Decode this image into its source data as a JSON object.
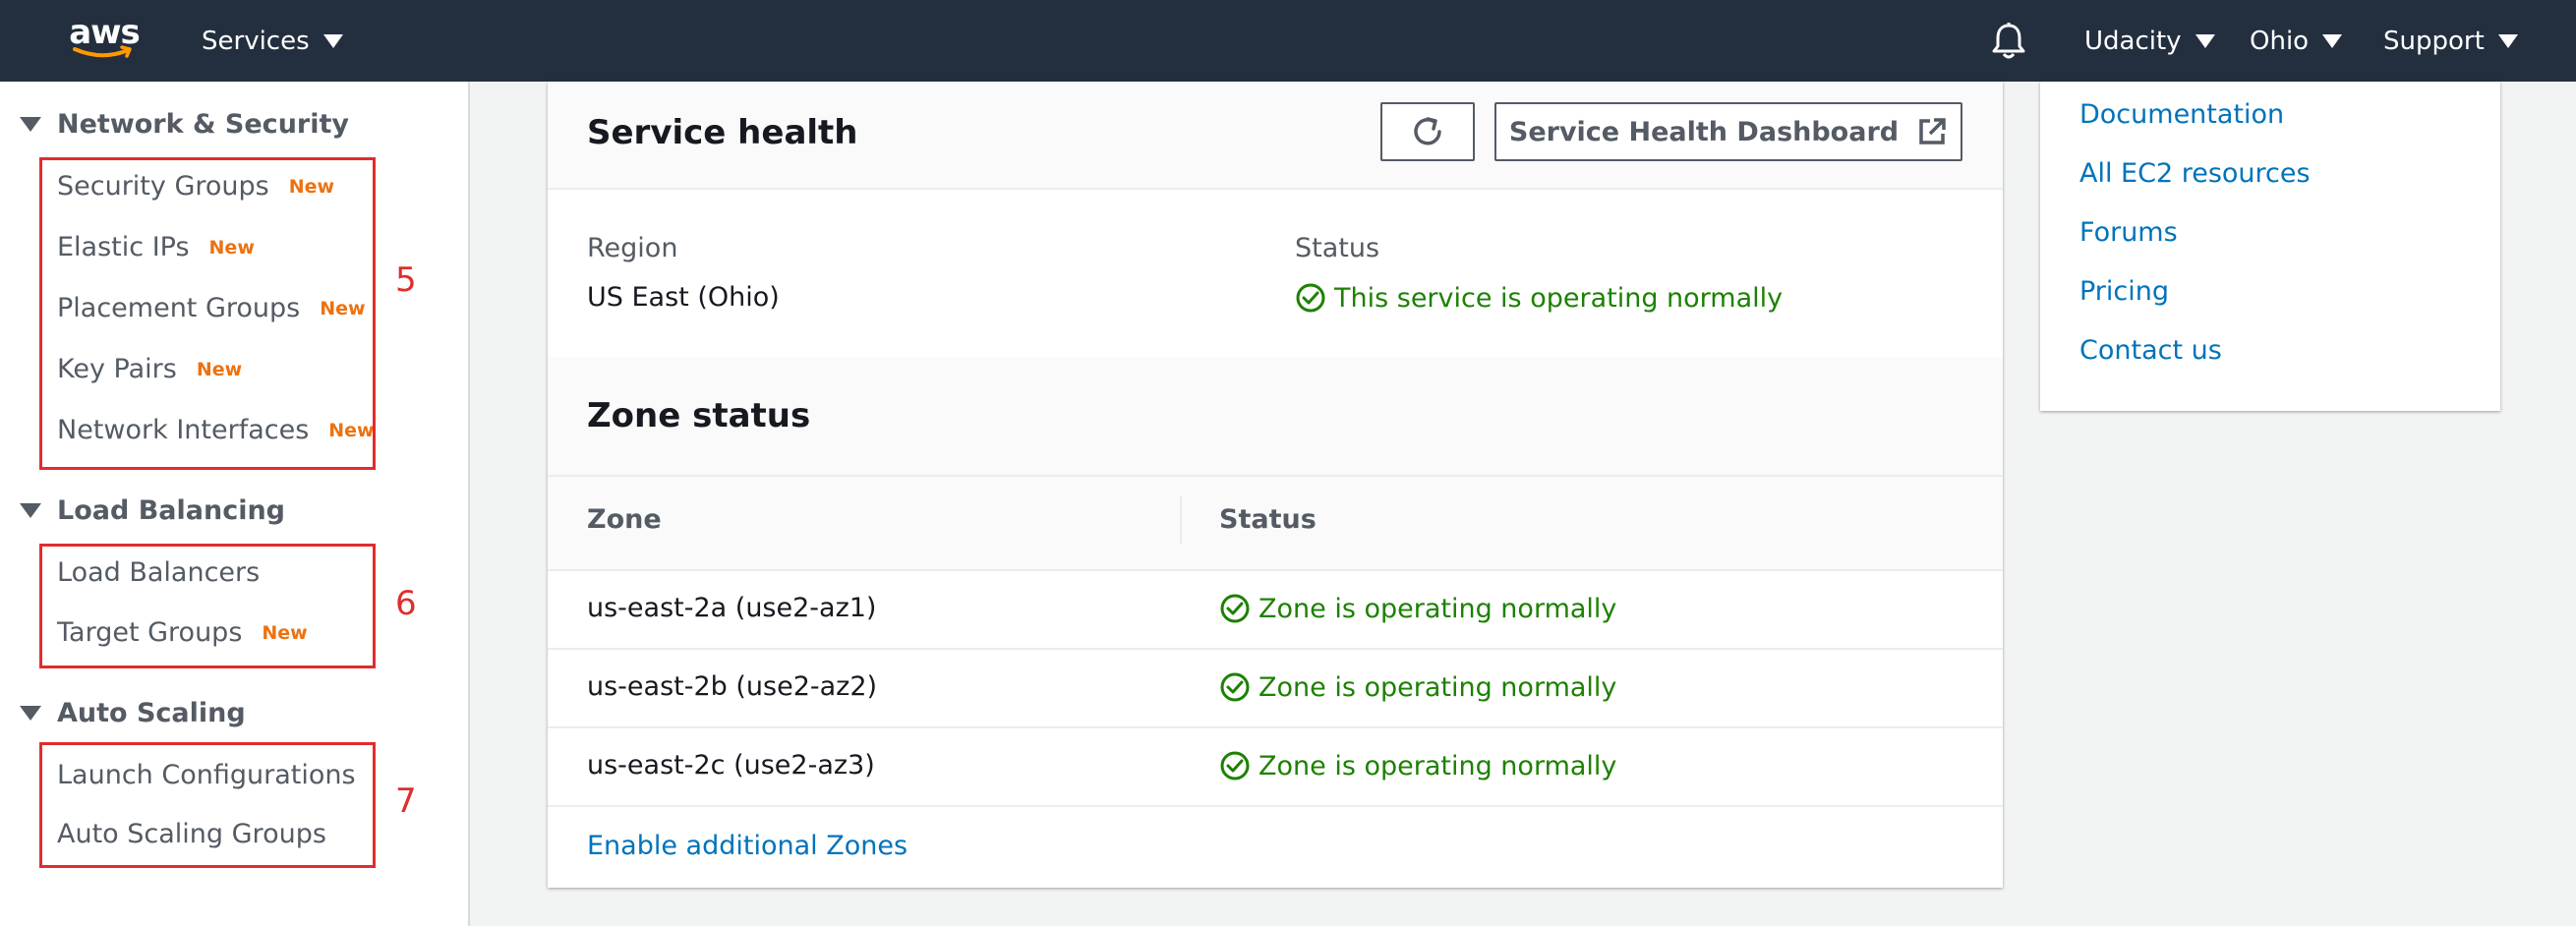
{
  "topnav": {
    "logo": "aws",
    "services_label": "Services",
    "bell_icon": "bell-icon",
    "account_label": "Udacity",
    "region_label": "Ohio",
    "support_label": "Support"
  },
  "sidebar": {
    "sections": [
      {
        "title": "Network & Security",
        "items": [
          {
            "label": "Security Groups",
            "badge": "New"
          },
          {
            "label": "Elastic IPs",
            "badge": "New"
          },
          {
            "label": "Placement Groups",
            "badge": "New"
          },
          {
            "label": "Key Pairs",
            "badge": "New"
          },
          {
            "label": "Network Interfaces",
            "badge": "New"
          }
        ],
        "annotation": "5"
      },
      {
        "title": "Load Balancing",
        "items": [
          {
            "label": "Load Balancers",
            "badge": ""
          },
          {
            "label": "Target Groups",
            "badge": "New"
          }
        ],
        "annotation": "6"
      },
      {
        "title": "Auto Scaling",
        "items": [
          {
            "label": "Launch Configurations",
            "badge": ""
          },
          {
            "label": "Auto Scaling Groups",
            "badge": ""
          }
        ],
        "annotation": "7"
      }
    ]
  },
  "service_health": {
    "title": "Service health",
    "refresh_icon": "refresh-icon",
    "dashboard_button": "Service Health Dashboard",
    "region_label": "Region",
    "region_value": "US East (Ohio)",
    "status_label": "Status",
    "status_value": "This service is operating normally"
  },
  "zone_status": {
    "title": "Zone status",
    "columns": [
      "Zone",
      "Status"
    ],
    "rows": [
      {
        "zone": "us-east-2a (use2-az1)",
        "status": "Zone is operating normally"
      },
      {
        "zone": "us-east-2b (use2-az2)",
        "status": "Zone is operating normally"
      },
      {
        "zone": "us-east-2c (use2-az3)",
        "status": "Zone is operating normally"
      }
    ],
    "enable_link": "Enable additional Zones"
  },
  "right_links": [
    "Documentation",
    "All EC2 resources",
    "Forums",
    "Pricing",
    "Contact us"
  ],
  "colors": {
    "nav_bg": "#232f3e",
    "success": "#1d8102",
    "link": "#0073bb",
    "badge": "#ec7211",
    "annotation": "#e02d2d"
  }
}
